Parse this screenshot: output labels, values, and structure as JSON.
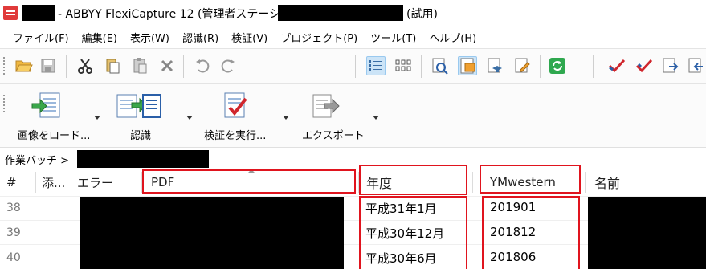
{
  "window": {
    "title_part1": "- ABBYY FlexiCapture 12 (管理者ステーション) -",
    "title_part2": "(試用)"
  },
  "menu": [
    "ファイル(F)",
    "編集(E)",
    "表示(W)",
    "認識(R)",
    "検証(V)",
    "プロジェクト(P)",
    "ツール(T)",
    "ヘルプ(H)"
  ],
  "toolbar2": {
    "load_images": "画像をロード...",
    "recognize": "認識",
    "verify": "検証を実行...",
    "export": "エクスポート"
  },
  "breadcrumb": {
    "label": "作業バッチ  >"
  },
  "grid": {
    "headers": {
      "num": "#",
      "attach": "添...",
      "error": "エラー",
      "pdf": "PDF",
      "year": "年度",
      "ymwestern": "YMwestern",
      "name": "名前"
    },
    "rows": [
      {
        "num": "38",
        "year": "平成31年1月",
        "ymwestern": "201901"
      },
      {
        "num": "39",
        "year": "平成30年12月",
        "ymwestern": "201812"
      },
      {
        "num": "40",
        "year": "平成30年6月",
        "ymwestern": "201806"
      }
    ]
  },
  "colors": {
    "highlight_red": "#e0141e",
    "active_blue": "#cce4f7"
  }
}
